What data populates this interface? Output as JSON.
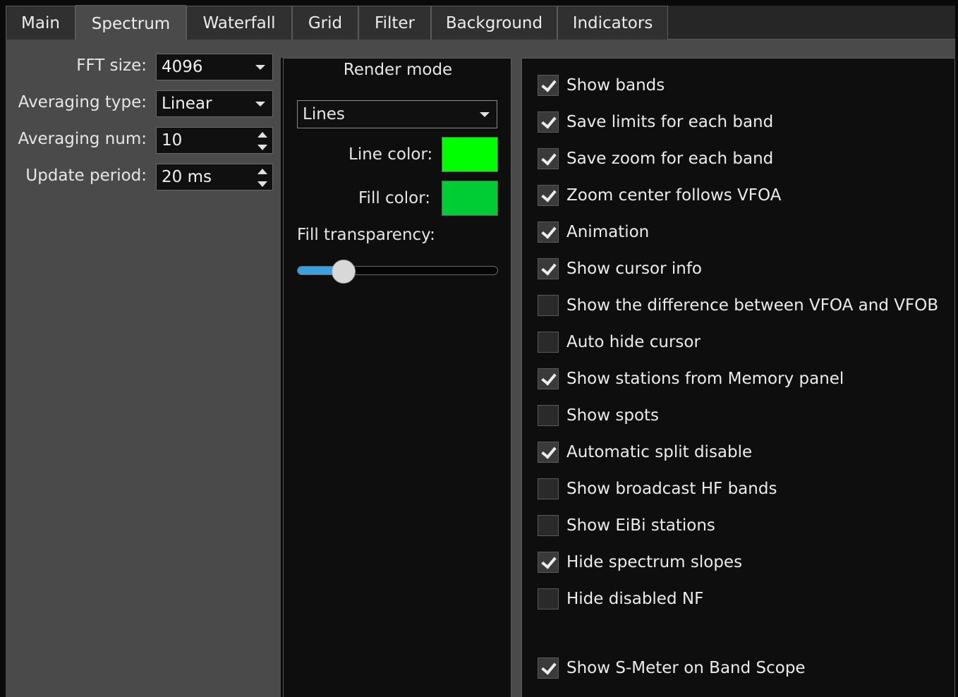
{
  "tabs": [
    "Main",
    "Spectrum",
    "Waterfall",
    "Grid",
    "Filter",
    "Background",
    "Indicators"
  ],
  "active_tab": "Spectrum",
  "left": {
    "fft_size_label": "FFT size:",
    "fft_size_value": "4096",
    "averaging_type_label": "Averaging type:",
    "averaging_type_value": "Linear",
    "averaging_num_label": "Averaging num:",
    "averaging_num_value": "10",
    "update_period_label": "Update period:",
    "update_period_value": "20 ms"
  },
  "middle": {
    "title": "Render mode",
    "render_mode_value": "Lines",
    "line_color_label": "Line color:",
    "line_color": "#00ff00",
    "fill_color_label": "Fill color:",
    "fill_color": "#00cc33",
    "fill_transparency_label": "Fill transparency:",
    "fill_transparency_fraction": 0.23
  },
  "checkboxes": [
    {
      "label": "Show bands",
      "checked": true
    },
    {
      "label": "Save limits for each band",
      "checked": true
    },
    {
      "label": "Save zoom for each band",
      "checked": true
    },
    {
      "label": "Zoom center follows VFOA",
      "checked": true
    },
    {
      "label": "Animation",
      "checked": true
    },
    {
      "label": "Show cursor info",
      "checked": true
    },
    {
      "label": "Show the difference between VFOA and VFOB",
      "checked": false
    },
    {
      "label": "Auto hide cursor",
      "checked": false
    },
    {
      "label": "Show stations from Memory panel",
      "checked": true
    },
    {
      "label": "Show spots",
      "checked": false
    },
    {
      "label": "Automatic split disable",
      "checked": true
    },
    {
      "label": "Show broadcast HF bands",
      "checked": false
    },
    {
      "label": "Show EiBi stations",
      "checked": false
    },
    {
      "label": "Hide spectrum slopes",
      "checked": true
    },
    {
      "label": "Hide disabled NF",
      "checked": false
    },
    {
      "label": "Show S-Meter on Band Scope",
      "checked": true
    }
  ]
}
